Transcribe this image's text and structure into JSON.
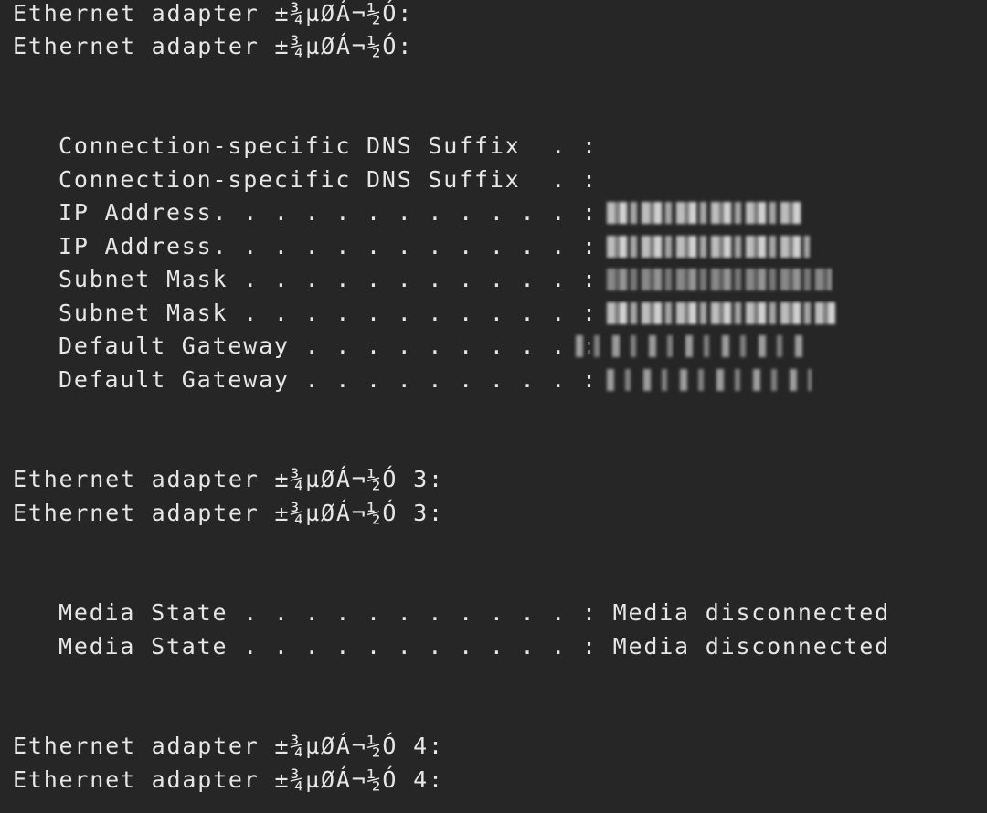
{
  "terminal": {
    "adapter_header_1": "Ethernet adapter ±¾µØÁ¬½Ó:",
    "adapter_header_1_dup": "Ethernet adapter ±¾µØÁ¬½Ó:",
    "dns_suffix_label": "Connection-specific DNS Suffix  . :",
    "dns_suffix_label_dup": "Connection-specific DNS Suffix  . :",
    "ip_label": "IP Address. . . . . . . . . . . . :",
    "ip_label_dup": "IP Address. . . . . . . . . . . . :",
    "subnet_label": "Subnet Mask . . . . . . . . . . . :",
    "subnet_label_dup": "Subnet Mask . . . . . . . . . . . :",
    "gateway_label": "Default Gateway . . . . . . . . . :",
    "gateway_label_dup": "Default Gateway . . . . . . . . . :",
    "adapter_header_3": "Ethernet adapter ±¾µØÁ¬½Ó 3:",
    "adapter_header_3_dup": "Ethernet adapter ±¾µØÁ¬½Ó 3:",
    "media_state_line": "Media State . . . . . . . . . . . : Media disconnected",
    "media_state_line_dup": "Media State . . . . . . . . . . . : Media disconnected",
    "adapter_header_4": "Ethernet adapter ±¾µØÁ¬½Ó 4:",
    "adapter_header_4_dup": "Ethernet adapter ±¾µØÁ¬½Ó 4:"
  },
  "colors": {
    "background": "#262626",
    "text": "#e6e6e6"
  }
}
